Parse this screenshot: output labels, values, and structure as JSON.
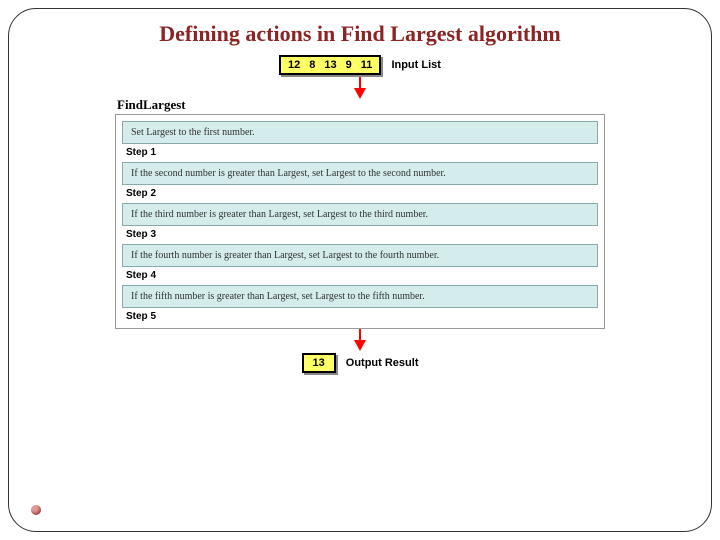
{
  "title": "Defining actions in Find Largest algorithm",
  "input": {
    "label": "Input List",
    "values": [
      "12",
      "8",
      "13",
      "9",
      "11"
    ]
  },
  "algorithm": {
    "name": "FindLargest",
    "steps": [
      {
        "label": "Step 1",
        "action": "Set Largest to the first number."
      },
      {
        "label": "Step 2",
        "action": "If the second number is greater than Largest, set Largest to the second number."
      },
      {
        "label": "Step 3",
        "action": "If the third number is greater than Largest, set Largest to the third number."
      },
      {
        "label": "Step 4",
        "action": "If the fourth number is greater than Largest, set Largest to the fourth number."
      },
      {
        "label": "Step 5",
        "action": "If the fifth number is greater than Largest, set Largest to the fifth number."
      }
    ]
  },
  "output": {
    "label": "Output Result",
    "value": "13"
  }
}
